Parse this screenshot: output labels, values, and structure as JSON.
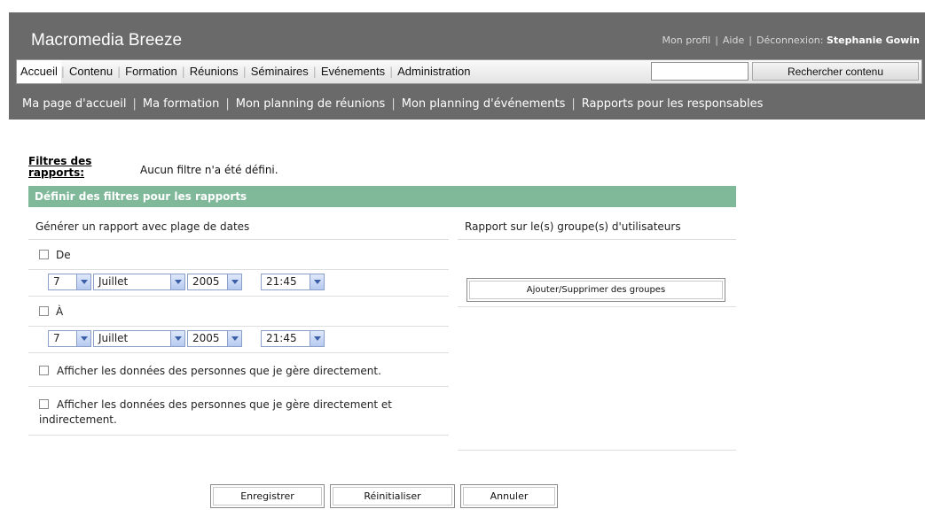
{
  "header": {
    "brand": "Macromedia Breeze",
    "links": {
      "profile": "Mon profil",
      "help": "Aide",
      "logout": "Déconnexion:",
      "user": "Stephanie Gowin"
    }
  },
  "tabs": [
    "Accueil",
    "Contenu",
    "Formation",
    "Réunions",
    "Séminaires",
    "Evénements",
    "Administration"
  ],
  "search": {
    "button": "Rechercher contenu",
    "value": ""
  },
  "subnav": [
    "Ma page d'accueil",
    "Ma formation",
    "Mon planning de réunions",
    "Mon planning d'événements",
    "Rapports pour les responsables"
  ],
  "filters": {
    "label": "Filtres des rapports:",
    "status": "Aucun filtre n'a été défini.",
    "section_title": "Définir des filtres pour les rapports"
  },
  "date_range": {
    "title": "Générer un rapport avec plage de dates",
    "from_label": "De",
    "to_label": "À",
    "from": {
      "day": "7",
      "month": "Juillet",
      "year": "2005",
      "time": "21:45"
    },
    "to": {
      "day": "7",
      "month": "Juillet",
      "year": "2005",
      "time": "21:45"
    }
  },
  "options": {
    "direct": "Afficher les données des personnes que je gère directement.",
    "indirect": "Afficher les données des personnes que je gère directement et indirectement."
  },
  "groups": {
    "title": "Rapport sur le(s) groupe(s) d'utilisateurs",
    "button": "Ajouter/Supprimer des groupes"
  },
  "actions": {
    "save": "Enregistrer",
    "reset": "Réinitialiser",
    "cancel": "Annuler"
  },
  "colors": {
    "header_bg": "#6a6a6a",
    "section_bg": "#80b89a",
    "select_border": "#8aa0c8"
  }
}
